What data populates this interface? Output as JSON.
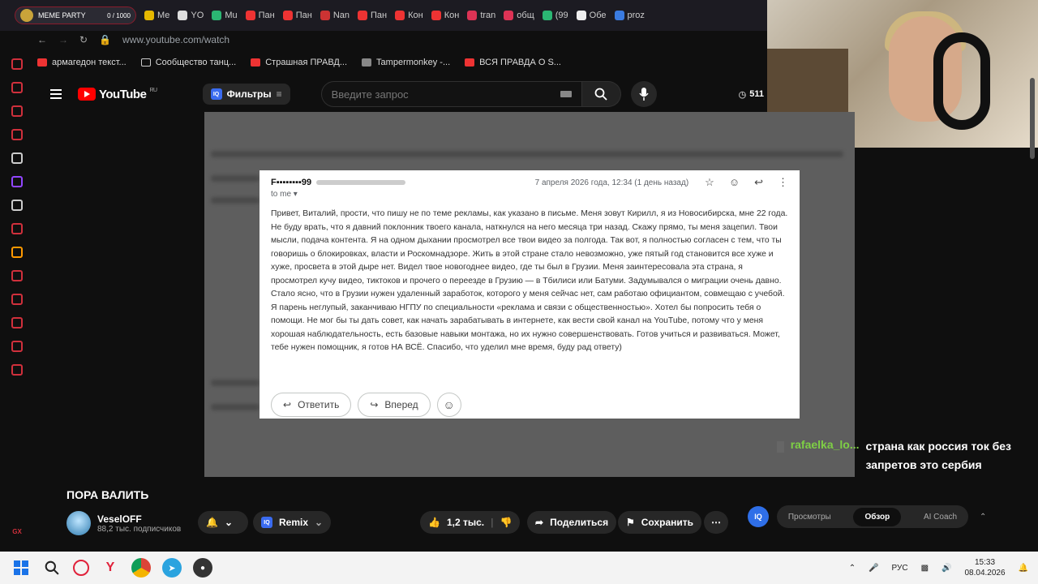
{
  "browser": {
    "logo_label": "MEME PARTY",
    "logo_counter": "0 / 1000",
    "tabs": [
      "Ме",
      "YO",
      "Mu",
      "Пан",
      "Пан",
      "Nan",
      "Пан",
      "Кон",
      "Кон",
      "tran",
      "общ",
      "(99",
      "Обе",
      "proz"
    ],
    "url": "www.youtube.com/watch",
    "bookmarks": [
      "армагедон текст...",
      "Сообщество танц...",
      "Страшная ПРАВД...",
      "Tampermonkey -...",
      "ВСЯ ПРАВДА О S..."
    ]
  },
  "youtube": {
    "logo_text": "YouTube",
    "logo_region": "RU",
    "filters_label": "Фильтры",
    "iq_label": "IQ",
    "search_placeholder": "Введите запрос",
    "header_count": "511"
  },
  "email": {
    "from": "F▪▪▪▪▪▪▪▪99",
    "date": "7 апреля 2026 года, 12:34 (1 день назад)",
    "to": "to me",
    "body": "Привет, Виталий, прости, что пишу не по теме рекламы, как указано в письме. Меня зовут Кирилл, я из Новосибирска, мне 22 года. Не буду врать, что я давний поклонник твоего канала, наткнулся на него месяца три назад. Скажу прямо, ты меня зацепил. Твои мысли, подача контента. Я на одном дыхании просмотрел все твои видео за полгода. Так вот, я полностью согласен с тем, что ты говоришь о блокировках, власти и Роскомнадзоре. Жить в этой стране стало невозможно, уже пятый год становится все хуже и хуже, просвета в этой дыре нет. Видел твое новогоднее видео, где ты был в Грузии. Меня заинтересовала эта страна, я просмотрел кучу видео, тиктоков и прочего о переезде в Грузию — в Тбилиси или Батуми. Задумывался о миграции очень давно. Стало ясно, что в Грузии нужен удаленный заработок, которого у меня сейчас нет, сам работаю официантом, совмещаю с учебой. Я парень неглупый, заканчиваю НГПУ по специальности «реклама и связи с общественностью». Хотел бы попросить тебя о помощи. Не мог бы ты дать совет, как начать зарабатывать в интернете, как вести свой канал на YouTube, потому что у меня хорошая наблюдательность, есть базовые навыки монтажа, но их нужно совершенствовать. Готов учиться и развиваться. Может, тебе нужен помощник, я готов НА ВСЁ. Спасибо, что уделил мне время, буду рад ответу)",
    "reply_label": "Ответить",
    "forward_label": "Вперед"
  },
  "chat": {
    "user": "rafaelka_lo...",
    "message": "страна как россия ток без запретов это сербия"
  },
  "video": {
    "title": "ПОРА ВАЛИТЬ",
    "channel": "VeselOFF",
    "subscribers": "88,2 тыс. подписчиков",
    "remix_label": "Remix",
    "likes": "1,2 тыс.",
    "share_label": "Поделиться",
    "save_label": "Сохранить"
  },
  "panel": {
    "tabs": [
      "Просмотры",
      "Обзор",
      "AI Coach"
    ],
    "active_tab": "Обзор"
  },
  "taskbar": {
    "lang": "РУС",
    "time": "15:33",
    "date": "08.04.2026"
  },
  "colors": {
    "accent": "#ff0000",
    "gx_red": "#d0303c",
    "chat_user": "#7ecf45"
  }
}
